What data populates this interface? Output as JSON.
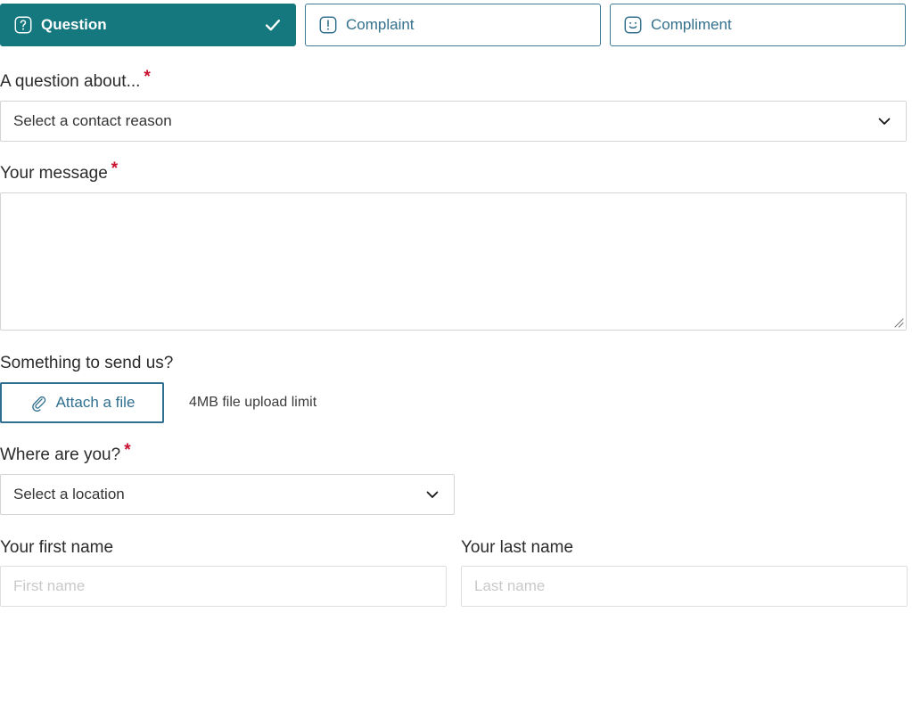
{
  "theme": {
    "accent_teal": "#15787f",
    "link_blue": "#33708c",
    "required_red": "#c8102e",
    "border_grey": "#d4d4d4",
    "placeholder_grey": "#c9c9c9"
  },
  "tabs": [
    {
      "label": "Question",
      "icon": "question-mark-icon",
      "selected": true,
      "check_icon": "check-icon"
    },
    {
      "label": "Complaint",
      "icon": "exclamation-mark-icon",
      "selected": false
    },
    {
      "label": "Compliment",
      "icon": "smiley-face-icon",
      "selected": false
    }
  ],
  "fields": {
    "question_about": {
      "label": "A question about...",
      "required_marker": "*",
      "select_value": "Select a contact reason",
      "chevron": "chevron-down-icon"
    },
    "message": {
      "label": "Your message",
      "required_marker": "*",
      "value": ""
    },
    "attachment": {
      "heading": "Something to send us?",
      "button_label": "Attach a file",
      "button_icon": "paperclip-icon",
      "hint": "4MB file upload limit"
    },
    "location": {
      "label": "Where are you?",
      "required_marker": "*",
      "select_value": "Select a location",
      "chevron": "chevron-down-icon"
    },
    "first_name": {
      "label": "Your first name",
      "placeholder": "First name",
      "value": ""
    },
    "last_name": {
      "label": "Your last name",
      "placeholder": "Last name",
      "value": ""
    }
  }
}
